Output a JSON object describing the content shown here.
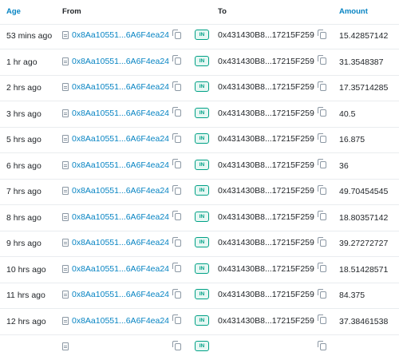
{
  "headers": {
    "age": "Age",
    "from": "From",
    "to": "To",
    "amount": "Amount"
  },
  "direction_label": "IN",
  "rows": [
    {
      "age": "53 mins ago",
      "from": "0x8Aa10551...6A6F4ea24",
      "to": "0x431430B8...17215F259",
      "amount": "15.42857142"
    },
    {
      "age": "1 hr ago",
      "from": "0x8Aa10551...6A6F4ea24",
      "to": "0x431430B8...17215F259",
      "amount": "31.3548387"
    },
    {
      "age": "2 hrs ago",
      "from": "0x8Aa10551...6A6F4ea24",
      "to": "0x431430B8...17215F259",
      "amount": "17.35714285"
    },
    {
      "age": "3 hrs ago",
      "from": "0x8Aa10551...6A6F4ea24",
      "to": "0x431430B8...17215F259",
      "amount": "40.5"
    },
    {
      "age": "5 hrs ago",
      "from": "0x8Aa10551...6A6F4ea24",
      "to": "0x431430B8...17215F259",
      "amount": "16.875"
    },
    {
      "age": "6 hrs ago",
      "from": "0x8Aa10551...6A6F4ea24",
      "to": "0x431430B8...17215F259",
      "amount": "36"
    },
    {
      "age": "7 hrs ago",
      "from": "0x8Aa10551...6A6F4ea24",
      "to": "0x431430B8...17215F259",
      "amount": "49.70454545"
    },
    {
      "age": "8 hrs ago",
      "from": "0x8Aa10551...6A6F4ea24",
      "to": "0x431430B8...17215F259",
      "amount": "18.80357142"
    },
    {
      "age": "9 hrs ago",
      "from": "0x8Aa10551...6A6F4ea24",
      "to": "0x431430B8...17215F259",
      "amount": "39.27272727"
    },
    {
      "age": "10 hrs ago",
      "from": "0x8Aa10551...6A6F4ea24",
      "to": "0x431430B8...17215F259",
      "amount": "18.51428571"
    },
    {
      "age": "11 hrs ago",
      "from": "0x8Aa10551...6A6F4ea24",
      "to": "0x431430B8...17215F259",
      "amount": "84.375"
    },
    {
      "age": "12 hrs ago",
      "from": "0x8Aa10551...6A6F4ea24",
      "to": "0x431430B8...17215F259",
      "amount": "37.38461538"
    }
  ],
  "colors": {
    "link": "#0784c3",
    "in_badge": "#00a186",
    "in_badge_bg": "#e6f7f3",
    "border": "#e9ecef"
  },
  "icons": {
    "contract": "document-icon",
    "copy": "copy-icon"
  }
}
